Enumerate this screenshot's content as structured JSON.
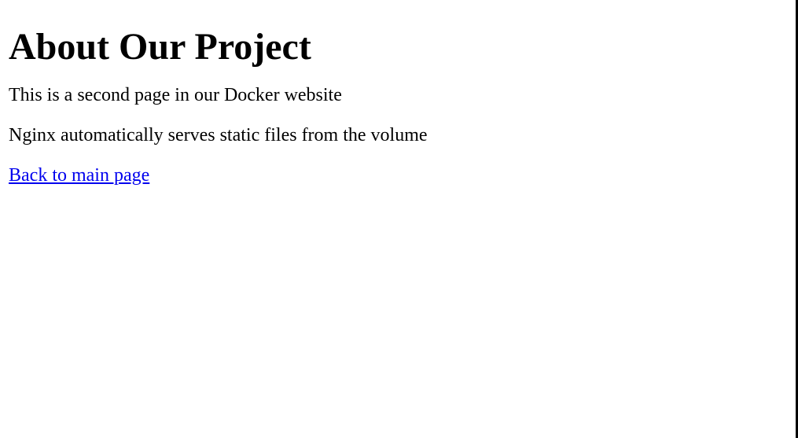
{
  "page": {
    "title": "About Our Project",
    "paragraphs": [
      "This is a second page in our Docker website",
      "Nginx automatically serves static files from the volume"
    ],
    "back_link": "Back to main page"
  },
  "colors": {
    "text": "#000000",
    "link": "#0000ee",
    "background": "#ffffff"
  }
}
